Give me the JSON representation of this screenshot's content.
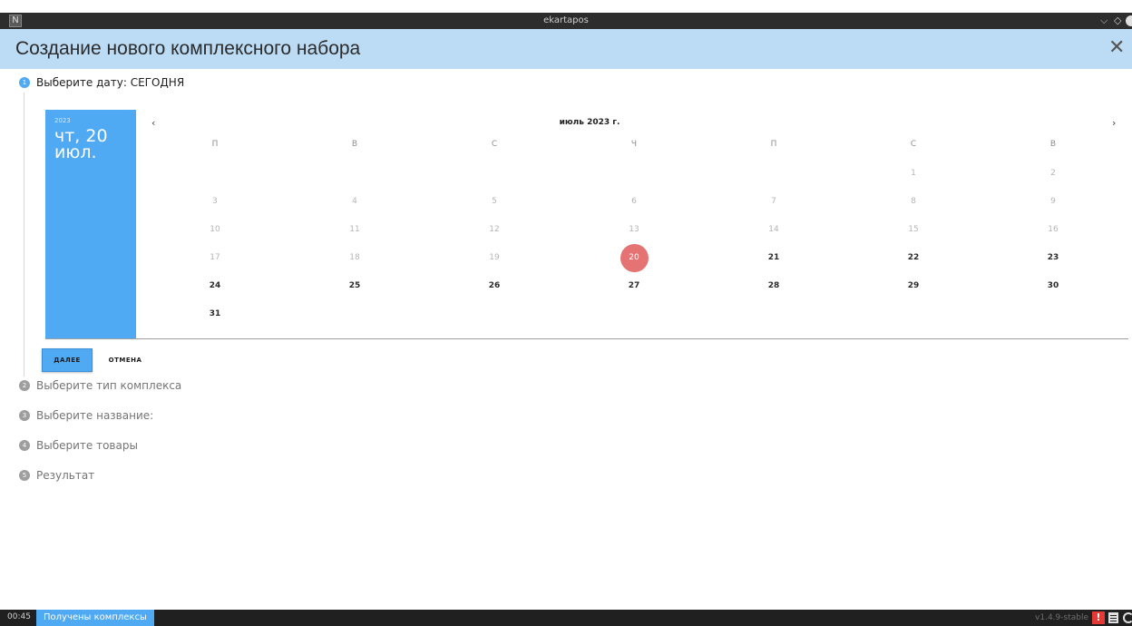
{
  "window": {
    "title": "ekartapos",
    "app_icon_glyph": "N",
    "controls": {
      "minimize": "⌵",
      "maximize": "◇"
    }
  },
  "dialog": {
    "title": "Создание нового комплексного набора",
    "close_glyph": "✕"
  },
  "steps": [
    {
      "number": "1",
      "label": "Выберите дату: СЕГОДНЯ",
      "state": "active"
    },
    {
      "number": "2",
      "label": "Выберите тип комплекса",
      "state": "inactive"
    },
    {
      "number": "3",
      "label": "Выберите название:",
      "state": "inactive"
    },
    {
      "number": "4",
      "label": "Выберите товары",
      "state": "inactive"
    },
    {
      "number": "5",
      "label": "Результат",
      "state": "inactive"
    }
  ],
  "calendar": {
    "side_year": "2023",
    "side_date": "чт, 20 июл.",
    "month_label": "июль 2023 г.",
    "prev_glyph": "‹",
    "next_glyph": "›",
    "weekdays": [
      "П",
      "В",
      "С",
      "Ч",
      "П",
      "С",
      "В"
    ],
    "weeks": [
      [
        "",
        "",
        "",
        "",
        "",
        "1",
        "2"
      ],
      [
        "3",
        "4",
        "5",
        "6",
        "7",
        "8",
        "9"
      ],
      [
        "10",
        "11",
        "12",
        "13",
        "14",
        "15",
        "16"
      ],
      [
        "17",
        "18",
        "19",
        "20",
        "21",
        "22",
        "23"
      ],
      [
        "24",
        "25",
        "26",
        "27",
        "28",
        "29",
        "30"
      ],
      [
        "31",
        "",
        "",
        "",
        "",
        "",
        ""
      ]
    ],
    "today": "20"
  },
  "buttons": {
    "next": "ДАЛЕЕ",
    "cancel": "ОТМЕНА"
  },
  "statusbar": {
    "time": "00:45",
    "message": "Получены комплексы",
    "version": "v1.4.9-stable",
    "warning_glyph": "!"
  },
  "colors": {
    "accent": "#4fa9f3",
    "header_bg": "#bcdcf5",
    "today_bg": "#e57373",
    "warning": "#e53935"
  },
  "icons": {
    "app": "app-logo-icon",
    "close": "close-icon",
    "prev": "chevron-left-icon",
    "next": "chevron-right-icon",
    "warning": "warning-icon",
    "document": "document-icon",
    "sync": "sync-icon"
  }
}
